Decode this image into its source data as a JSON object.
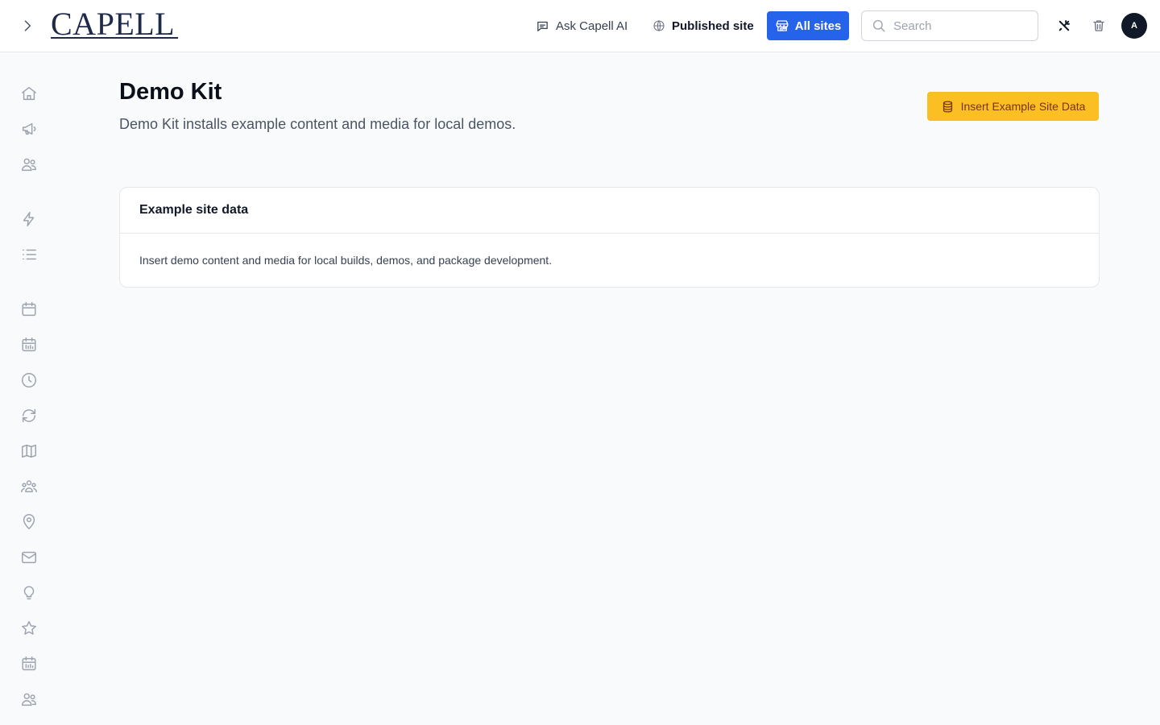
{
  "header": {
    "logo_text": "CAPELL",
    "ask_ai_label": "Ask Capell AI",
    "published_site_label": "Published site",
    "all_sites_label": "All sites",
    "search_placeholder": "Search",
    "avatar_initial": "A"
  },
  "sidebar": {
    "icons": [
      "home-icon",
      "megaphone-icon",
      "users-icon",
      "bolt-icon",
      "list-icon",
      "calendar-icon",
      "calendar-grid-icon",
      "clock-icon",
      "refresh-icon",
      "map-icon",
      "user-group-icon",
      "map-pin-icon",
      "envelope-icon",
      "lightbulb-icon",
      "star-icon",
      "calendar-grid-icon",
      "users-icon"
    ]
  },
  "main": {
    "title": "Demo Kit",
    "subtitle": "Demo Kit installs example content and media for local demos.",
    "insert_button_label": "Insert Example Site Data",
    "card": {
      "title": "Example site data",
      "body": "Insert demo content and media for local builds, demos, and package development."
    }
  },
  "colors": {
    "primary": "#2563eb",
    "accent": "#fbbf24",
    "accent_text": "#78350f",
    "background": "#f9fafc"
  }
}
